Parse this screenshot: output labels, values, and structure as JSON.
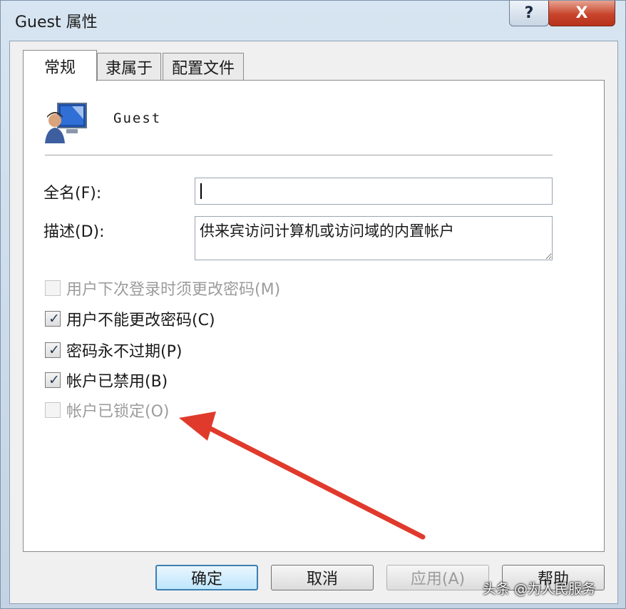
{
  "window": {
    "title": "Guest 属性",
    "help_label": "?",
    "close_label": "X"
  },
  "tabs": [
    {
      "label": "常规",
      "active": true
    },
    {
      "label": "隶属于",
      "active": false
    },
    {
      "label": "配置文件",
      "active": false
    }
  ],
  "user": {
    "name": "Guest",
    "icon": "user-computer-icon"
  },
  "fields": {
    "fullname_label": "全名(F):",
    "fullname_value": "",
    "desc_label": "描述(D):",
    "desc_value": "供来宾访问计算机或访问域的内置帐户"
  },
  "checkboxes": [
    {
      "label": "用户下次登录时须更改密码(M)",
      "checked": false,
      "enabled": false
    },
    {
      "label": "用户不能更改密码(C)",
      "checked": true,
      "enabled": true
    },
    {
      "label": "密码永不过期(P)",
      "checked": true,
      "enabled": true
    },
    {
      "label": "帐户已禁用(B)",
      "checked": true,
      "enabled": true
    },
    {
      "label": "帐户已锁定(O)",
      "checked": false,
      "enabled": false
    }
  ],
  "buttons": {
    "ok": "确定",
    "cancel": "取消",
    "apply": "应用(A)",
    "help": "帮助"
  },
  "annotation": {
    "arrow_color": "#e03a2c"
  },
  "watermark": "头条 @为人民服务"
}
